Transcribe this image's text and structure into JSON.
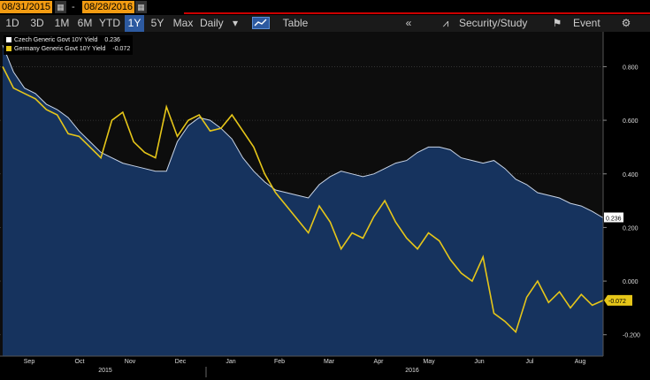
{
  "toolbar": {
    "start_date": "08/31/2015",
    "end_date": "08/28/2016",
    "dash": "-",
    "ranges": [
      "1D",
      "3D",
      "1M",
      "6M",
      "YTD",
      "1Y",
      "5Y",
      "Max"
    ],
    "selected_range": "1Y",
    "interval": "Daily",
    "table_label": "Table",
    "security_study_label": "Security/Study",
    "event_label": "Event"
  },
  "colors": {
    "czech": "#ffffff",
    "germany": "#e6c619",
    "area_fill": "#16335e",
    "bg": "#0d0d0d"
  },
  "chart_data": {
    "type": "line",
    "series": [
      {
        "name": "Czech Generic Govt 10Y Yield",
        "last": "0.236",
        "values": [
          0.88,
          0.78,
          0.72,
          0.7,
          0.66,
          0.64,
          0.61,
          0.56,
          0.52,
          0.48,
          0.46,
          0.44,
          0.43,
          0.42,
          0.41,
          0.41,
          0.52,
          0.58,
          0.61,
          0.6,
          0.57,
          0.53,
          0.46,
          0.41,
          0.37,
          0.34,
          0.33,
          0.32,
          0.31,
          0.36,
          0.39,
          0.41,
          0.4,
          0.39,
          0.4,
          0.42,
          0.44,
          0.45,
          0.48,
          0.5,
          0.5,
          0.49,
          0.46,
          0.45,
          0.44,
          0.45,
          0.42,
          0.38,
          0.36,
          0.33,
          0.32,
          0.31,
          0.29,
          0.28,
          0.26,
          0.236
        ]
      },
      {
        "name": "Germany Generic Govt 10Y Yield",
        "last": "-0.072",
        "values": [
          0.8,
          0.72,
          0.7,
          0.68,
          0.64,
          0.62,
          0.55,
          0.54,
          0.5,
          0.46,
          0.6,
          0.63,
          0.52,
          0.48,
          0.46,
          0.65,
          0.54,
          0.6,
          0.62,
          0.56,
          0.57,
          0.62,
          0.56,
          0.5,
          0.4,
          0.33,
          0.28,
          0.23,
          0.18,
          0.28,
          0.22,
          0.12,
          0.18,
          0.16,
          0.24,
          0.3,
          0.22,
          0.16,
          0.12,
          0.18,
          0.15,
          0.08,
          0.03,
          0.0,
          0.09,
          -0.12,
          -0.15,
          -0.19,
          -0.06,
          0.0,
          -0.08,
          -0.04,
          -0.1,
          -0.05,
          -0.09,
          -0.072
        ]
      }
    ],
    "x_ticks": [
      "Sep",
      "Oct",
      "Nov",
      "Dec",
      "Jan",
      "Feb",
      "Mar",
      "Apr",
      "May",
      "Jun",
      "Jul",
      "Aug"
    ],
    "x_years": [
      "2015",
      "2016"
    ],
    "y_ticks": [
      "0.800",
      "0.600",
      "0.400",
      "0.200",
      "0.000",
      "-0.200"
    ],
    "y_tick_values": [
      0.8,
      0.6,
      0.4,
      0.2,
      0.0,
      -0.2
    ],
    "ylim": [
      -0.28,
      0.93
    ]
  }
}
